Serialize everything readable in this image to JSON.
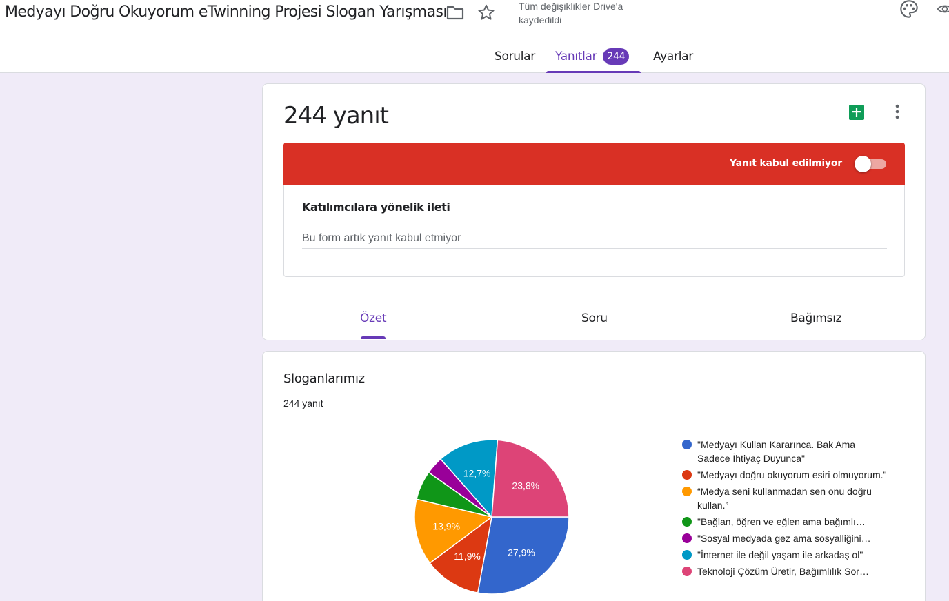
{
  "header": {
    "form_title": "Medyayı Doğru Okuyorum eTwinning Projesi Slogan Yarışması",
    "save_status": "Tüm değişiklikler Drive'a kaydedildi",
    "icons": [
      "folder-icon",
      "star-icon",
      "palette-icon",
      "eye-icon"
    ]
  },
  "tabs": {
    "sorular": "Sorular",
    "yanitlar": "Yanıtlar",
    "yanitlar_badge": "244",
    "ayarlar": "Ayarlar",
    "active": "yanitlar"
  },
  "summary": {
    "response_count": "244 yanıt",
    "banner_label": "Yanıt kabul edilmiyor",
    "accepting_responses": false,
    "message_label": "Katılımcılara yönelik ileti",
    "message_value": "Bu form artık yanıt kabul etmiyor",
    "subtabs": {
      "ozet": "Özet",
      "soru": "Soru",
      "bagimsiz": "Bağımsız"
    },
    "active_subtab": "ozet"
  },
  "colors": {
    "accent": "#673ab7",
    "banner": "#d93025",
    "sheets_green": "#0f9d58"
  },
  "question": {
    "title": "Sloganlarımız",
    "count": "244 yanıt"
  },
  "chart_data": {
    "type": "pie",
    "title": "",
    "series": [
      {
        "label": "\"Medyayı Kullan Kararınca. Bak Ama Sadece İhtiyaç Duyunca\"",
        "percent": 27.9,
        "display": "27,9%",
        "color": "#3366cc"
      },
      {
        "label": "\"Medyayı doğru okuyorum esiri olmuyorum.\"",
        "percent": 11.9,
        "display": "11,9%",
        "color": "#dc3912"
      },
      {
        "label": "“Medya seni kullanmadan sen onu doğru kullan.”",
        "percent": 13.9,
        "display": "13,9%",
        "color": "#ff9900"
      },
      {
        "label": "\"Bağlan, öğren ve eğlen ama bağımlı…",
        "percent": 6.1,
        "display": "",
        "color": "#109618"
      },
      {
        "label": "\"Sosyal medyada gez ama sosyalliğini…",
        "percent": 3.7,
        "display": "",
        "color": "#990099"
      },
      {
        "label": "\"İnternet ile değil yaşam ile arkadaş ol\"",
        "percent": 12.7,
        "display": "12,7%",
        "color": "#0099c6"
      },
      {
        "label": "Teknoloji Çözüm Üretir, Bağımlılık Sor…",
        "percent": 23.8,
        "display": "23,8%",
        "color": "#dd4477"
      }
    ],
    "legend_position": "right"
  }
}
